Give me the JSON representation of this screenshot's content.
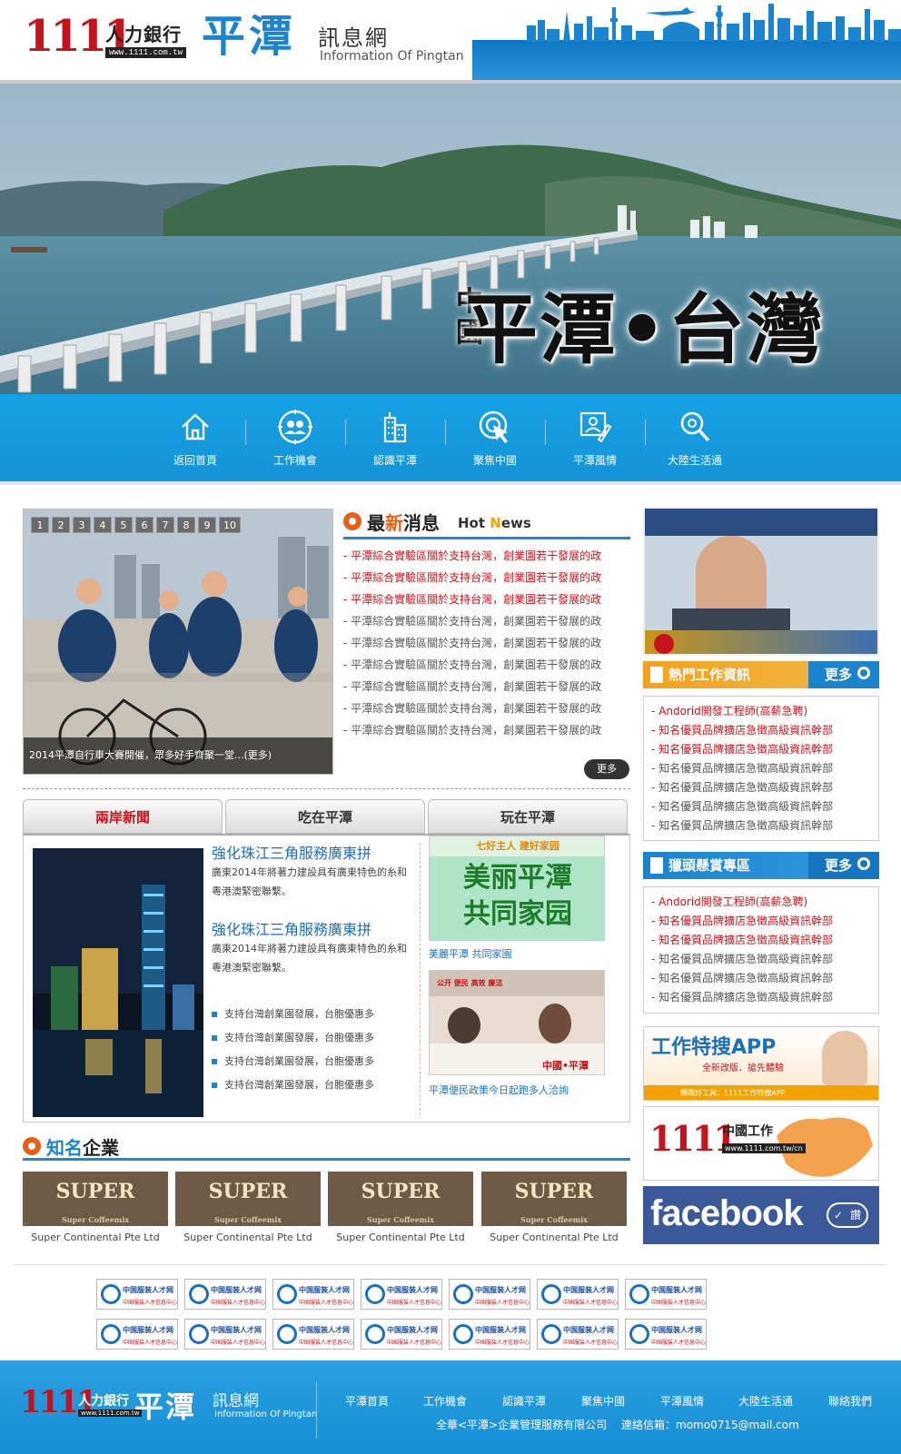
{
  "header": {
    "logo_number": "1111",
    "logo_brand": "人力銀行",
    "logo_url": "www.1111.com.tw",
    "site_title": "平潭",
    "site_title_suffix": "訊息網",
    "site_subtitle": "Information Of Pingtan"
  },
  "banner": {
    "title_small": "中國",
    "title_main": "平潭•台灣"
  },
  "nav": {
    "items": [
      {
        "label": "返回首頁",
        "icon": "home-icon"
      },
      {
        "label": "工作機會",
        "icon": "people-icon"
      },
      {
        "label": "認識平潭",
        "icon": "buildings-icon"
      },
      {
        "label": "聚焦中國",
        "icon": "target-cursor-icon"
      },
      {
        "label": "平潭風情",
        "icon": "picture-frame-icon"
      },
      {
        "label": "大陸生活通",
        "icon": "search-icon"
      }
    ]
  },
  "slider": {
    "pages": [
      "1",
      "2",
      "3",
      "4",
      "5",
      "6",
      "7",
      "8",
      "9",
      "10"
    ],
    "caption": "2014平潭自行車大賽開催，眾多好手齊聚一堂...(更多)"
  },
  "hot_news": {
    "title_part1": "最",
    "title_part2": "新",
    "title_part3": "消息",
    "title_en1": "Hot ",
    "title_en2": "N",
    "title_en3": "ews",
    "items": [
      {
        "text": "- 平潭綜合實驗區關於支持台灣，創業園若干發展的政",
        "color": "#d0121b"
      },
      {
        "text": "- 平潭綜合實驗區關於支持台灣，創業園若干發展的政",
        "color": "#d0121b"
      },
      {
        "text": "- 平潭綜合實驗區關於支持台灣，創業園若干發展的政",
        "color": "#d0121b"
      },
      {
        "text": "- 平潭綜合實驗區關於支持台灣，創業園若干發展的政",
        "color": "#555555"
      },
      {
        "text": "- 平潭綜合實驗區關於支持台灣，創業園若干發展的政",
        "color": "#555555"
      },
      {
        "text": "- 平潭綜合實驗區關於支持台灣，創業園若干發展的政",
        "color": "#555555"
      },
      {
        "text": "- 平潭綜合實驗區關於支持台灣，創業園若干發展的政",
        "color": "#555555"
      },
      {
        "text": "- 平潭綜合實驗區關於支持台灣，創業園若干發展的政",
        "color": "#555555"
      },
      {
        "text": "- 平潭綜合實驗區關於支持台灣，創業園若干發展的政",
        "color": "#555555"
      }
    ],
    "more_label": "更多"
  },
  "tabs": {
    "items": [
      "兩岸新聞",
      "吃在平潭",
      "玩在平潭"
    ],
    "active_color": "#d0121b"
  },
  "tab_content": {
    "articles": [
      {
        "title": "強化珠江三角服務廣東拼",
        "body": "廣東2014年將著力建設具有廣東特色的糸和粵港澳緊密聯繫。"
      },
      {
        "title": "強化珠江三角服務廣東拼",
        "body": "廣東2014年將著力建設具有廣東特色的糸和粵港澳緊密聯繫。"
      }
    ],
    "bullets": [
      "支持台灣創業園發展，台胞優惠多",
      "支持台灣創業園發展，台胞優惠多",
      "支持台灣創業園發展，台胞優惠多",
      "支持台灣創業園發展，台胞優惠多"
    ],
    "promo_banner_line1": "美丽平潭",
    "promo_banner_line2": "共同家园",
    "promo_banner_top": "七好主人  建好家园",
    "promo_caption": "美麗平潭 共同家園",
    "photo_sign": "公开  便民  高效  廉洁",
    "photo_stamp": "中國•平潭",
    "photo_caption": "平潭便民政策今日起跑多人洽詢"
  },
  "companies": {
    "title_part1": "知名",
    "title_part2": "企業",
    "logo_text": "SUPER",
    "logo_sub": "Super Coffeemix",
    "items": [
      "Super Continental Pte Ltd",
      "Super Continental Pte Ltd",
      "Super Continental Pte Ltd",
      "Super Continental Pte Ltd"
    ]
  },
  "sidebar": {
    "video_sign": "...",
    "hot_jobs": {
      "title": "熱門工作資訊",
      "more": "更多",
      "items": [
        {
          "text": "- Andorid開發工程師(高薪急聘)",
          "color": "#d0121b"
        },
        {
          "text": "- 知名優質品牌擴店急徵高級資訊幹部",
          "color": "#d0121b"
        },
        {
          "text": "- 知名優質品牌擴店急徵高級資訊幹部",
          "color": "#d0121b"
        },
        {
          "text": "- 知名優質品牌擴店急徵高級資訊幹部",
          "color": "#555555"
        },
        {
          "text": "- 知名優質品牌擴店急徵高級資訊幹部",
          "color": "#555555"
        },
        {
          "text": "- 知名優質品牌擴店急徵高級資訊幹部",
          "color": "#555555"
        },
        {
          "text": "- 知名優質品牌擴店急徵高級資訊幹部",
          "color": "#555555"
        }
      ]
    },
    "headhunter": {
      "title": "獵頭懸賞專區",
      "more": "更多",
      "items": [
        {
          "text": "- Andorid開發工程師(高薪急聘)",
          "color": "#d0121b"
        },
        {
          "text": "- 知名優質品牌擴店急徵高級資訊幹部",
          "color": "#d0121b"
        },
        {
          "text": "- 知名優質品牌擴店急徵高級資訊幹部",
          "color": "#d0121b"
        },
        {
          "text": "- 知名優質品牌擴店急徵高級資訊幹部",
          "color": "#555555"
        },
        {
          "text": "- 知名優質品牌擴店急徵高級資訊幹部",
          "color": "#555555"
        },
        {
          "text": "- 知名優質品牌擴店急徵高級資訊幹部",
          "color": "#555555"
        }
      ]
    },
    "app_ad": {
      "title": "工作特搜APP",
      "sub": "全新改版．搶先體驗",
      "footer": "轉職好工具：1111工作特搜APP"
    },
    "china_ad": {
      "number": "1111",
      "text": "中國工作",
      "url": "www.1111.com.tw/cn"
    },
    "facebook": {
      "label": "facebook",
      "like": "讚"
    }
  },
  "links": {
    "logo_title": "中国服装人才网",
    "logo_sub": "中国服装人才信息中心",
    "logo_mark": "FWON",
    "row1_count": 7,
    "row2_count": 7
  },
  "footer": {
    "logo_number": "1111",
    "logo_brand": "人力銀行",
    "logo_url": "www.1111.com.tw",
    "site_title": "平潭",
    "site_title_suffix": "訊息網",
    "site_subtitle": "Information Of Pingtan",
    "links": [
      "平潭首頁",
      "工作機會",
      "認識平潭",
      "聚焦中國",
      "平潭風情",
      "大陸生活通",
      "聯絡我們"
    ],
    "company": "全華<平潭>企業管理服務有限公司",
    "contact_label": "連絡信箱：",
    "contact_email": "momo0715@mail.com"
  },
  "colors": {
    "accent_blue": "#1a84cf",
    "nav_blue": "#17a2e6",
    "red": "#d0121b",
    "orange": "#f2a300"
  }
}
